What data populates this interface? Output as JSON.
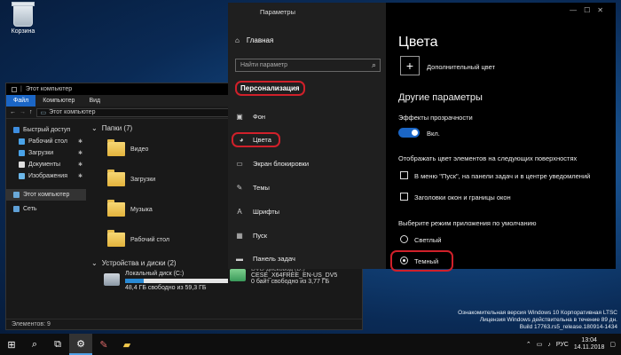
{
  "desktop": {
    "recycle_bin_label": "Корзина"
  },
  "explorer": {
    "title": "Этот компьютер",
    "ribbon_tabs": [
      "Файл",
      "Компьютер",
      "Вид"
    ],
    "address": "Этот компьютер",
    "nav": {
      "quick_access": "Быстрый доступ",
      "items": [
        "Рабочий стол",
        "Загрузки",
        "Документы",
        "Изображения"
      ],
      "this_pc": "Этот компьютер",
      "network": "Сеть"
    },
    "folders_header": "Папки (7)",
    "folders": [
      "Видео",
      "Загрузки",
      "Музыка",
      "Рабочий стол"
    ],
    "devices_header": "Устройства и диски (2)",
    "drives": [
      {
        "name": "Локальный диск (C:)",
        "free": "48,4 ГБ свободно из 59,3 ГБ",
        "used_fraction": 0.18
      },
      {
        "name": "DVD-дисковод (D:)",
        "label": "CESE_X64FREE_EN-US_DV5",
        "free": "0 байт свободно из 3,77 ГБ"
      }
    ],
    "status": "Элементов: 9"
  },
  "settings": {
    "title": "Параметры",
    "home": "Главная",
    "search_placeholder": "Найти параметр",
    "section": "Персонализация",
    "nav_items": [
      "Фон",
      "Цвета",
      "Экран блокировки",
      "Темы",
      "Шрифты",
      "Пуск",
      "Панель задач"
    ],
    "page_title": "Цвета",
    "custom_color": "Дополнительный цвет",
    "other_header": "Другие параметры",
    "transparency_label": "Эффекты прозрачности",
    "transparency_state": "Вкл.",
    "surfaces_label": "Отображать цвет элементов на следующих поверхностях",
    "check_start": "В меню \"Пуск\", на панели задач и в центре уведомлений",
    "check_titles": "Заголовки окон и границы окон",
    "mode_label": "Выберите режим приложения по умолчанию",
    "mode_light": "Светлый",
    "mode_dark": "Темный"
  },
  "watermark": {
    "line1": "Ознакомительная версия Windows 10 Корпоративная LTSC",
    "line2": "Лицензия Windows действительна в течение 89 дн.",
    "line3": "Build 17763.rs5_release.180914-1434"
  },
  "taskbar": {
    "lang": "РУС",
    "time": "13:04",
    "date": "14.11.2018"
  },
  "colors": {
    "accent": "#1b66c6",
    "highlight": "#d0202a"
  }
}
